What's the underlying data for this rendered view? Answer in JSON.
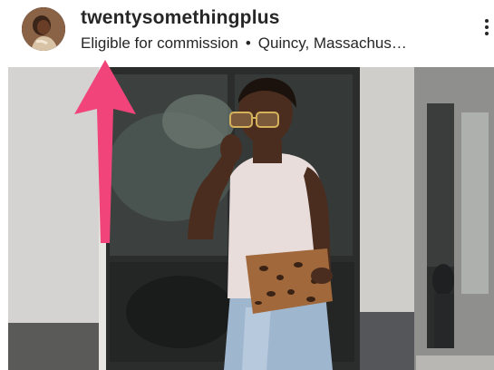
{
  "post": {
    "username": "twentysomethingplus",
    "commission_label": "Eligible for commission",
    "separator": "•",
    "location": "Quincy, Massachus…",
    "more_icon": "more-vertical-icon",
    "avatar_icon": "profile-avatar"
  },
  "annotation": {
    "arrow_color": "#f0447a",
    "arrow_icon": "arrow-up-icon"
  },
  "colors": {
    "text": "#262626",
    "background": "#ffffff"
  }
}
